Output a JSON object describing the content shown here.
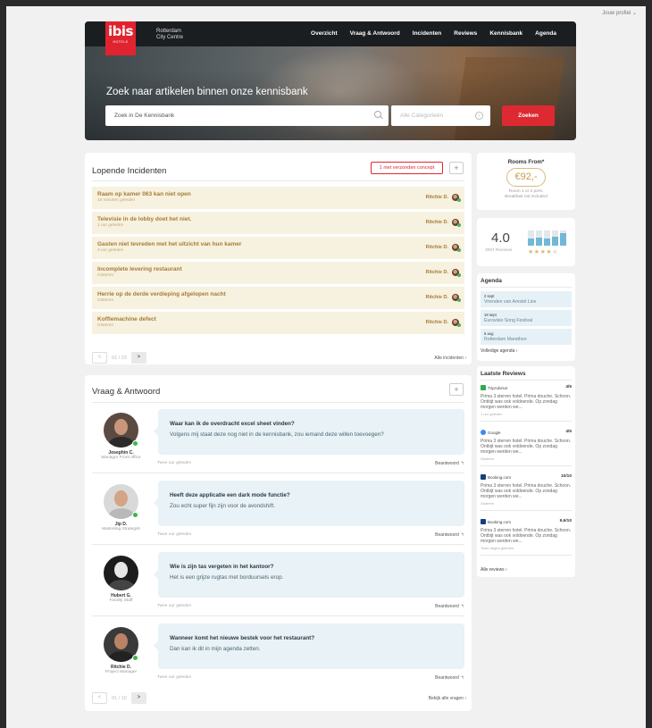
{
  "profile": "Jouw profiel",
  "brand": {
    "logo": "ibis",
    "logo_sub": "HOTELS",
    "hotel_line1": "Rotterdam",
    "hotel_line2": "City Centre"
  },
  "nav": [
    "Overzicht",
    "Vraag & Antwoord",
    "Incidenten",
    "Reviews",
    "Kennisbank",
    "Agenda"
  ],
  "hero": {
    "title": "Zoek naar artikelen binnen onze kennisbank",
    "search_value": "Zoek in De Kennisbank",
    "category_placeholder": "Alle Categorieën",
    "search_button": "Zoeken"
  },
  "incidents": {
    "title": "Lopende Incidenten",
    "concept_button": "1 niet verzonden concept",
    "add_button": "+",
    "items": [
      {
        "title": "Raam op kamer 063 kan niet open",
        "time": "10 minuten geleden",
        "assignee": "Ritchie D."
      },
      {
        "title": "Televisie in de lobby doet het niet.",
        "time": "1 uur geleden",
        "assignee": "Ritchie D."
      },
      {
        "title": "Gasten niet tevreden met het uitzicht van hun kamer",
        "time": "3 uur geleden",
        "assignee": "Ritchie D."
      },
      {
        "title": "Incomplete levering restaurant",
        "time": "Gisteren",
        "assignee": "Ritchie D."
      },
      {
        "title": "Herrie op de derde verdieping afgelopen nacht",
        "time": "Gisteren",
        "assignee": "Ritchie D."
      },
      {
        "title": "Koffiemachine defect",
        "time": "Gisteren",
        "assignee": "Ritchie D."
      }
    ],
    "pager": {
      "prev": "<",
      "text": "01 / 23",
      "next": ">"
    },
    "all_link": "Alle incidenten ›"
  },
  "qa": {
    "title": "Vraag & Antwoord",
    "add_button": "+",
    "items": [
      {
        "question": "Waar kan ik de overdracht excel sheet vinden?",
        "body": "Volgens mij staat deze nog niet in de kennisbank, zou iemand deze willen toevoegen?",
        "name": "Josephin C.",
        "role": "Manager Front office",
        "time": "Twee uur geleden",
        "action": "Beantwoord"
      },
      {
        "question": "Heeft deze applicatie een dark mode functie?",
        "body": "Zou echt super fijn zijn voor de avondshift.",
        "name": "Jip D.",
        "role": "Marketing Strategist",
        "time": "Twee uur geleden",
        "action": "Beantwoord"
      },
      {
        "question": "Wie is zijn tas vergeten in het kantoor?",
        "body": "Het is een grijze rugtas met borduursels erop.",
        "name": "Hubert G.",
        "role": "Facility Staff",
        "time": "Twee uur geleden",
        "action": "Beantwoord"
      },
      {
        "question": "Wanneer komt het nieuwe bestek voor het restaurant?",
        "body": "Dan kan ik dit in mijn agenda zetten.",
        "name": "Ritchie D.",
        "role": "Project Manager",
        "time": "Twee uur geleden",
        "action": "Beantwoord"
      }
    ],
    "pager": {
      "prev": "<",
      "text": "01 / 10",
      "next": ">"
    },
    "all_link": "Bekijk alle vragen ›"
  },
  "rooms": {
    "label": "Rooms From*",
    "price": "€92,-",
    "sub1": "Room 1 or 2 pers.",
    "sub2": "Breakfast not included"
  },
  "rating": {
    "score": "4.0",
    "count": "3067 Reviews",
    "distribution": [
      0.5,
      0.55,
      0.45,
      0.6,
      0.8
    ],
    "stars": 4
  },
  "agenda": {
    "title": "Agenda",
    "items": [
      {
        "date": "2 sept",
        "event": "Vrienden van Amstel Live"
      },
      {
        "date": "18 sept",
        "event": "Eurovisie Song Festival"
      },
      {
        "date": "6 aug",
        "event": "Rotterdam Marathon"
      }
    ],
    "more": "Volledige agenda ›"
  },
  "reviews": {
    "title": "Laatste Reviews",
    "items": [
      {
        "source": "TripAdvisor",
        "color": "#34a853",
        "score": "4/5",
        "text": "Prima 3 sterren hotel. Prima douche. Schoon. Ontbijt was ook voldoende. Op zondag morgen werden we...",
        "time": "1 uur geleden"
      },
      {
        "source": "Google",
        "color": "#4285f4",
        "score": "4/5",
        "text": "Prima 3 sterren hotel. Prima douche. Schoon. Ontbijt was ook voldoende. Op zondag morgen werden we...",
        "time": "Gisteren"
      },
      {
        "source": "Booking.com",
        "color": "#1a3d7c",
        "score": "10/10",
        "text": "Prima 3 sterren hotel. Prima douche. Schoon. Ontbijt was ook voldoende. Op zondag morgen werden we...",
        "time": "Gisteren"
      },
      {
        "source": "Booking.com",
        "color": "#1a3d7c",
        "score": "9,6/10",
        "text": "Prima 3 sterren hotel. Prima douche. Schoon. Ontbijt was ook voldoende. Op zondag morgen werden we...",
        "time": "Twee dagen geleden"
      }
    ],
    "more": "Alle reviews ›"
  },
  "colors": {
    "accent": "#dd2932",
    "incident_bg": "#f7f1df",
    "bubble_bg": "#e8f2f7",
    "online": "#3db54a"
  }
}
